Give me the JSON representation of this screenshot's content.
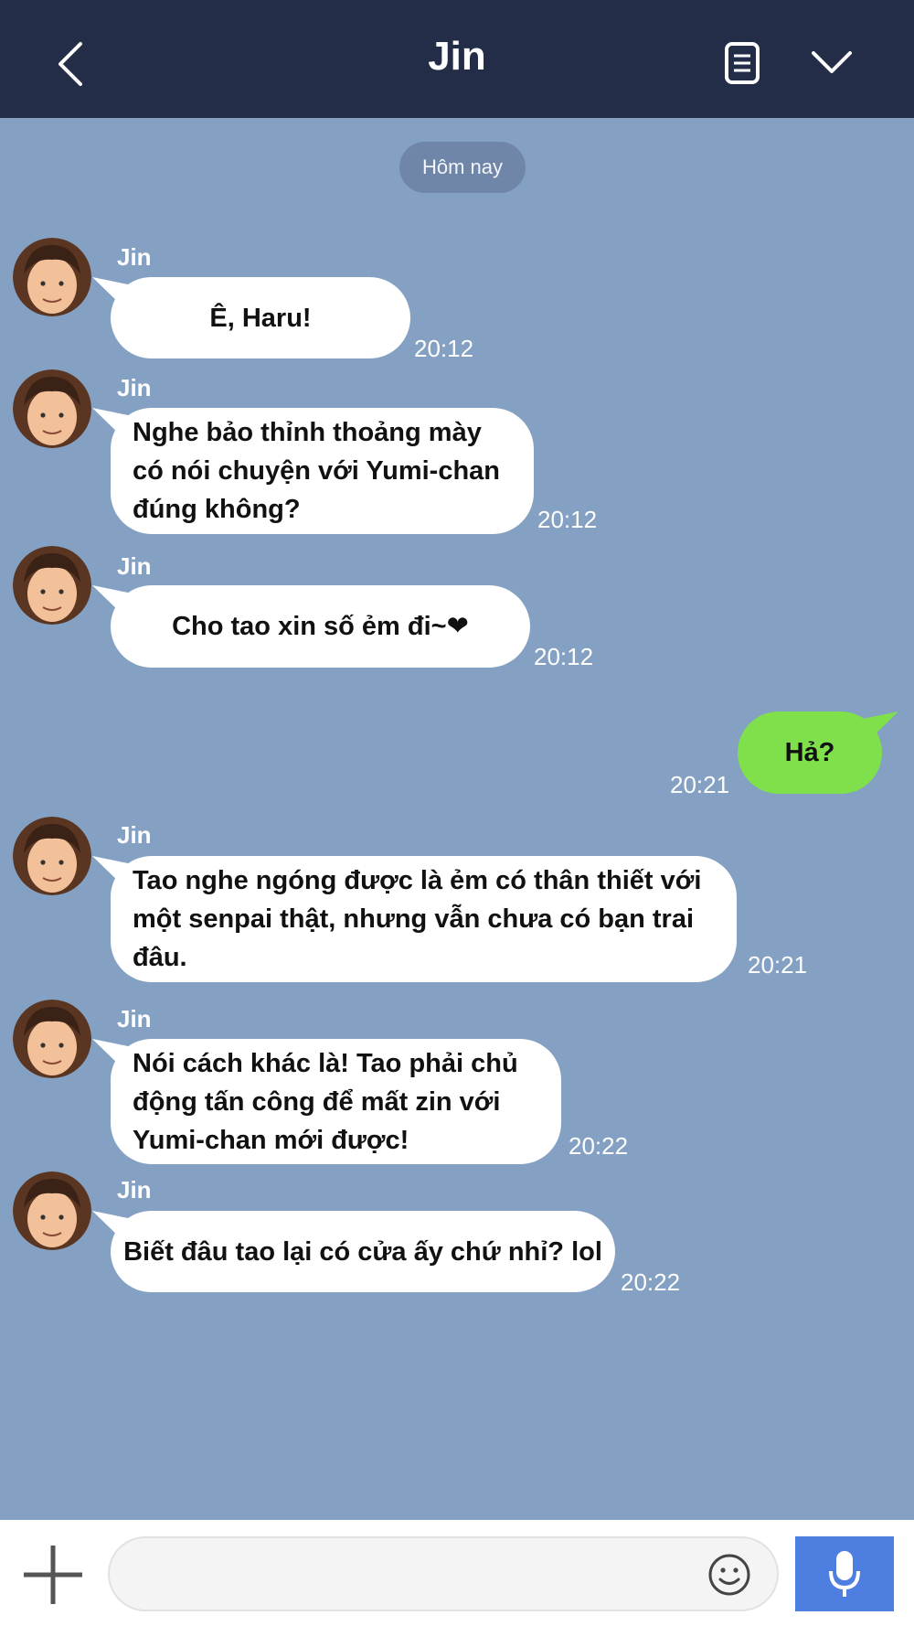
{
  "header": {
    "title": "Jin"
  },
  "date_label": "Hôm nay",
  "messages": [
    {
      "sender": "Jin",
      "text": "Ê, Haru!",
      "time": "20:12"
    },
    {
      "sender": "Jin",
      "lines": [
        "Nghe bảo thỉnh thoảng mày",
        "có nói chuyện với Yumi-chan",
        "đúng không?"
      ],
      "time": "20:12"
    },
    {
      "sender": "Jin",
      "text": "Cho tao xin số ẻm đi~❤",
      "time": "20:12"
    },
    {
      "text": "Hả?",
      "time": "20:21"
    },
    {
      "sender": "Jin",
      "lines": [
        "Tao nghe ngóng được là ẻm có thân thiết với",
        "một senpai thật, nhưng vẫn chưa có bạn trai",
        "đâu."
      ],
      "time": "20:21"
    },
    {
      "sender": "Jin",
      "lines": [
        "Nói cách khác là! Tao phải chủ",
        "động tấn công để mất zin với",
        "Yumi-chan mới được!"
      ],
      "time": "20:22"
    },
    {
      "sender": "Jin",
      "text": "Biết đâu tao lại có cửa ấy chứ nhỉ? lol",
      "time": "20:22"
    }
  ],
  "colors": {
    "header": "#232d48",
    "background": "#84a0c2",
    "outgoing": "#7fe04c",
    "mic": "#4e7fe0"
  },
  "icons": [
    "back-arrow-icon",
    "notes-icon",
    "chevron-down-icon",
    "plus-icon",
    "smile-icon",
    "microphone-icon"
  ]
}
